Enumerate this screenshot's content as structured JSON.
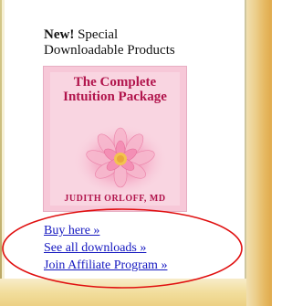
{
  "promo": {
    "new_label": "New!",
    "heading_rest": " Special",
    "heading_line2": "Downloadable Products"
  },
  "product": {
    "title_line1": "The Complete",
    "title_line2": "Intuition Package",
    "author": "JUDITH ORLOFF, MD"
  },
  "links": [
    {
      "label": "Buy here »"
    },
    {
      "label": "See all downloads »"
    },
    {
      "label": "Join Affiliate Program »"
    }
  ],
  "colors": {
    "link": "#1518c0",
    "product_title": "#b1144c",
    "highlight_oval": "#e01010"
  }
}
